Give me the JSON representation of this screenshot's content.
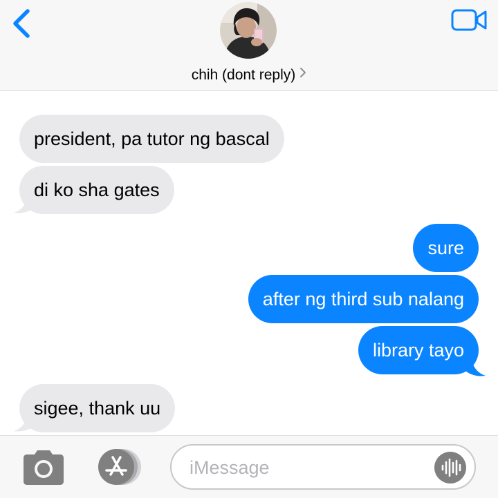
{
  "header": {
    "contact_name": "chih (dont reply)",
    "icons": {
      "back": "chevron-left-icon",
      "video": "video-camera-icon",
      "details": "chevron-right-icon"
    },
    "accent_color": "#0b84ff"
  },
  "messages": [
    {
      "direction": "incoming",
      "text": "president, pa tutor ng bascal"
    },
    {
      "direction": "incoming",
      "text": "di ko sha gates"
    },
    {
      "direction": "outgoing",
      "text": "sure"
    },
    {
      "direction": "outgoing",
      "text": "after ng third sub nalang"
    },
    {
      "direction": "outgoing",
      "text": "library tayo"
    },
    {
      "direction": "incoming",
      "text": "sigee, thank uu"
    }
  ],
  "colors": {
    "incoming_bubble": "#e9e9eb",
    "outgoing_bubble": "#0b84ff"
  },
  "composer": {
    "placeholder": "iMessage",
    "value": "",
    "icons": {
      "camera": "camera-icon",
      "apps": "app-store-icon",
      "audio": "audio-waveform-icon"
    }
  }
}
